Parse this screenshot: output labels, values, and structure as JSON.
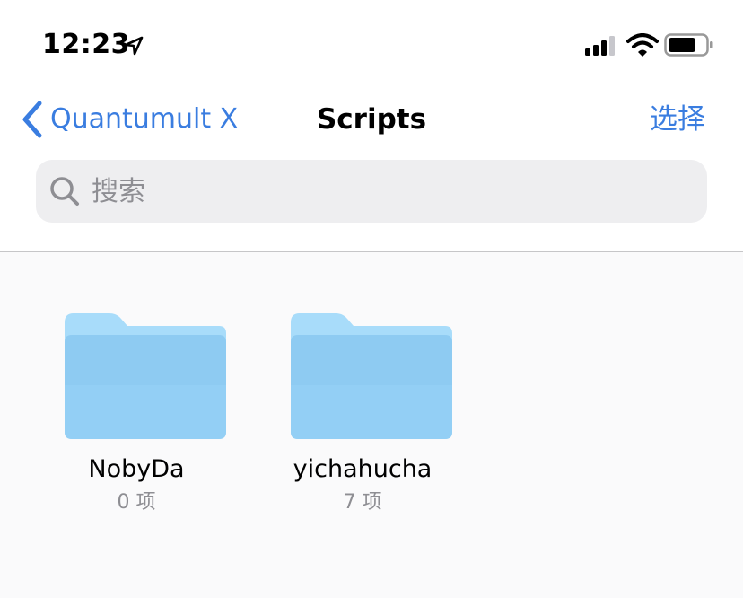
{
  "status_bar": {
    "time": "12:23",
    "icons": [
      "location-arrow-icon",
      "cellular-signal-icon",
      "wifi-icon",
      "battery-icon"
    ]
  },
  "nav": {
    "back_label": "Quantumult X",
    "title": "Scripts",
    "select_label": "选择"
  },
  "search": {
    "placeholder": "搜索",
    "value": ""
  },
  "folders": [
    {
      "name": "NobyDa",
      "count": "0 项"
    },
    {
      "name": "yichahucha",
      "count": "7 项"
    }
  ],
  "colors": {
    "accent": "#3a7de0",
    "folder_light": "#a8dcfa",
    "folder_dark": "#8ecbf2",
    "search_bg": "#eeeef0",
    "secondary_text": "#8e8e93"
  }
}
